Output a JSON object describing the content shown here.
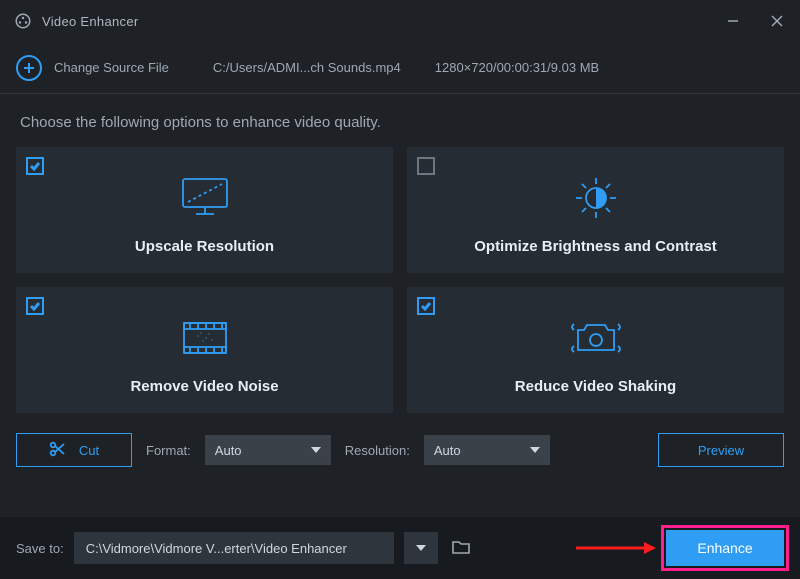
{
  "app": {
    "title": "Video Enhancer"
  },
  "source": {
    "change_label": "Change Source File",
    "path": "C:/Users/ADMI...ch Sounds.mp4",
    "info": "1280×720/00:00:31/9.03 MB"
  },
  "instruction": "Choose the following options to enhance video quality.",
  "options": [
    {
      "label": "Upscale Resolution",
      "checked": true
    },
    {
      "label": "Optimize Brightness and Contrast",
      "checked": false
    },
    {
      "label": "Remove Video Noise",
      "checked": true
    },
    {
      "label": "Reduce Video Shaking",
      "checked": true
    }
  ],
  "controls": {
    "cut_label": "Cut",
    "format_label": "Format:",
    "format_value": "Auto",
    "resolution_label": "Resolution:",
    "resolution_value": "Auto",
    "preview_label": "Preview"
  },
  "footer": {
    "save_to_label": "Save to:",
    "save_path": "C:\\Vidmore\\Vidmore V...erter\\Video Enhancer",
    "enhance_label": "Enhance"
  }
}
